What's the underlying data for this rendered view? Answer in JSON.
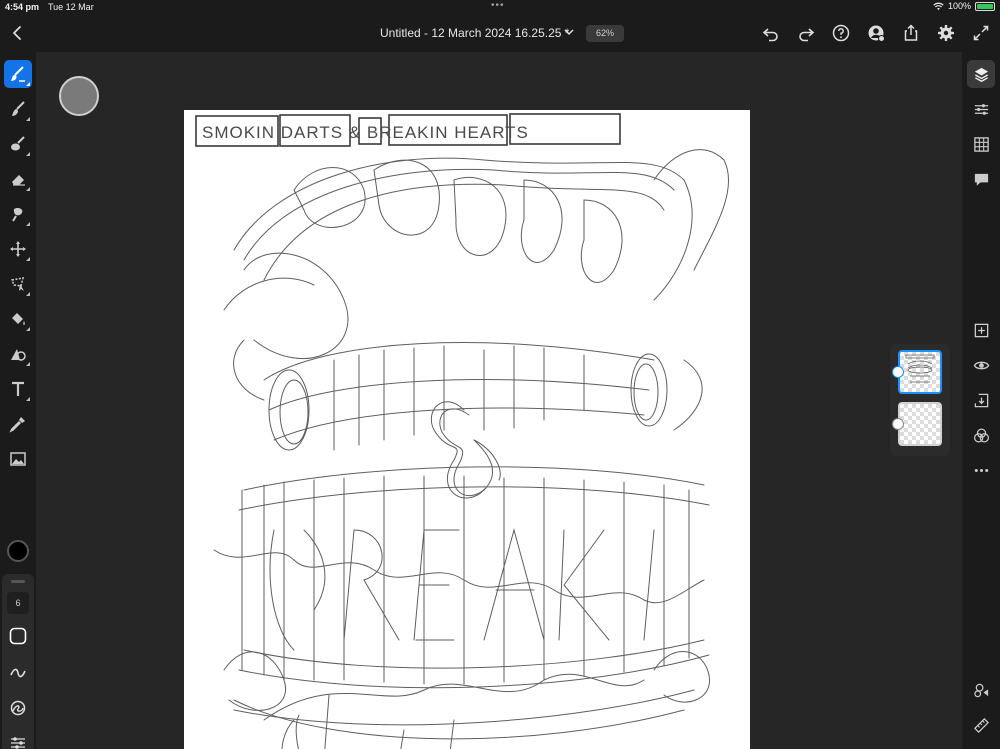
{
  "status_bar": {
    "time": "4:54 pm",
    "date": "Tue 12 Mar",
    "battery": "100%"
  },
  "header": {
    "title": "Untitled - 12 March 2024 16.25.25 *",
    "zoom": "62%"
  },
  "brush_settings": {
    "size": "6"
  },
  "colors": {
    "accent": "#1473e6",
    "toolbar_bg": "#1b1b1b",
    "workspace_bg": "#262626",
    "paper": "#ffffff",
    "current_color": "#000000"
  },
  "canvas": {
    "sketch_caption": "SMOKIN DARTS & BREAKIN HEARTS"
  }
}
